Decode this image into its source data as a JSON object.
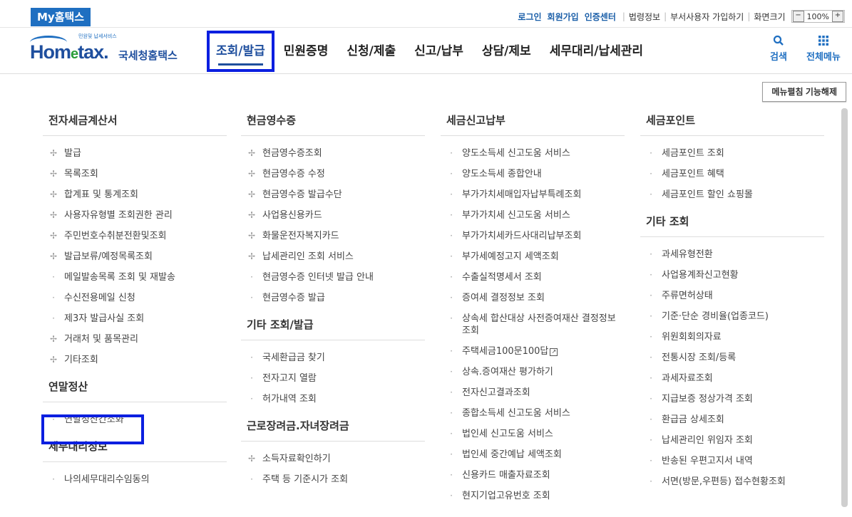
{
  "top": {
    "my_hometax": "My홈택스",
    "links": [
      "로그인",
      "회원가입",
      "인증센터"
    ],
    "plain_links": [
      "법령정보",
      "부서사용자 가입하기",
      "화면크기"
    ],
    "zoom_minus": "−",
    "zoom_value": "100%",
    "zoom_plus": "+"
  },
  "logo": {
    "small": "민원및 납세서비스",
    "word_home": "Hom",
    "word_e": "e",
    "word_tax": "tax.",
    "korean": "국세청홈택스"
  },
  "gnb": [
    "조회/발급",
    "민원증명",
    "신청/제출",
    "신고/납부",
    "상담/제보",
    "세무대리/납세관리"
  ],
  "header_icons": {
    "search": "검색",
    "all_menu": "전체메뉴"
  },
  "menu_collapse_button": "메뉴펼침 기능해제",
  "col1": {
    "s1_title": "전자세금계산서",
    "s1_items": [
      {
        "mk": "✢",
        "t": "발급"
      },
      {
        "mk": "✢",
        "t": "목록조회"
      },
      {
        "mk": "✢",
        "t": "합계표 및 통계조회"
      },
      {
        "mk": "✢",
        "t": "사용자유형별 조회권한 관리"
      },
      {
        "mk": "✢",
        "t": "주민번호수취분전환및조회"
      },
      {
        "mk": "✢",
        "t": "발급보류/예정목록조회"
      },
      {
        "mk": "·",
        "t": "메일발송목록 조회 및 재발송"
      },
      {
        "mk": "·",
        "t": "수신전용메일 신청"
      },
      {
        "mk": "·",
        "t": "제3자 발급사실 조회"
      },
      {
        "mk": "✢",
        "t": "거래처 및 품목관리"
      },
      {
        "mk": "✢",
        "t": "기타조회"
      }
    ],
    "s2_title": "연말정산",
    "s2_items": [
      {
        "mk": "·",
        "t": "연말정산간소화"
      }
    ],
    "s3_title": "세무대리정보",
    "s3_items": [
      {
        "mk": "·",
        "t": "나의세무대리수임동의"
      }
    ]
  },
  "col2": {
    "s1_title": "현금영수증",
    "s1_items": [
      {
        "mk": "✢",
        "t": "현금영수증조회"
      },
      {
        "mk": "✢",
        "t": "현금영수증 수정"
      },
      {
        "mk": "✢",
        "t": "현금영수증 발급수단"
      },
      {
        "mk": "✢",
        "t": "사업용신용카드"
      },
      {
        "mk": "✢",
        "t": "화물운전자복지카드"
      },
      {
        "mk": "✢",
        "t": "납세관리인 조회 서비스"
      },
      {
        "mk": "·",
        "t": "현금영수증 인터넷 발급 안내"
      },
      {
        "mk": "·",
        "t": "현금영수증 발급"
      }
    ],
    "s2_title": "기타 조회/발급",
    "s2_items": [
      {
        "mk": "·",
        "t": "국세환급금 찾기"
      },
      {
        "mk": "·",
        "t": "전자고지 열람"
      },
      {
        "mk": "·",
        "t": "허가내역 조회"
      }
    ],
    "s3_title": "근로장려금.자녀장려금",
    "s3_items": [
      {
        "mk": "✢",
        "t": "소득자료확인하기"
      },
      {
        "mk": "·",
        "t": "주택 등 기준시가 조회"
      }
    ]
  },
  "col3": {
    "s1_title": "세금신고납부",
    "s1_items": [
      {
        "mk": "·",
        "t": "양도소득세 신고도움 서비스"
      },
      {
        "mk": "·",
        "t": "양도소득세 종합안내"
      },
      {
        "mk": "·",
        "t": "부가가치세매입자납부특례조회"
      },
      {
        "mk": "·",
        "t": "부가가치세 신고도움 서비스"
      },
      {
        "mk": "·",
        "t": "부가가치세카드사대리납부조회"
      },
      {
        "mk": "·",
        "t": "부가세예정고지 세액조회"
      },
      {
        "mk": "·",
        "t": "수출실적명세서 조회"
      },
      {
        "mk": "·",
        "t": "증여세 결정정보 조회"
      },
      {
        "mk": "·",
        "t": "상속세 합산대상 사전증여재산 결정정보 조회"
      },
      {
        "mk": "·",
        "t": "주택세금100문100답"
      },
      {
        "mk": "·",
        "t": "상속.증여재산 평가하기"
      },
      {
        "mk": "·",
        "t": "전자신고결과조회"
      },
      {
        "mk": "·",
        "t": "종합소득세 신고도움 서비스"
      },
      {
        "mk": "·",
        "t": "법인세 신고도움 서비스"
      },
      {
        "mk": "·",
        "t": "법인세 중간예납 세액조회"
      },
      {
        "mk": "·",
        "t": "신용카드 매출자료조회"
      },
      {
        "mk": "·",
        "t": "현지기업고유번호 조회"
      }
    ]
  },
  "col4": {
    "s1_title": "세금포인트",
    "s1_items": [
      {
        "mk": "·",
        "t": "세금포인트 조회"
      },
      {
        "mk": "·",
        "t": "세금포인트 혜택"
      },
      {
        "mk": "·",
        "t": "세금포인트 할인 쇼핑몰"
      }
    ],
    "s2_title": "기타 조회",
    "s2_items": [
      {
        "mk": "·",
        "t": "과세유형전환"
      },
      {
        "mk": "·",
        "t": "사업용계좌신고현황"
      },
      {
        "mk": "·",
        "t": "주류면허상태"
      },
      {
        "mk": "·",
        "t": "기준·단순 경비율(업종코드)"
      },
      {
        "mk": "·",
        "t": "위원회회의자료"
      },
      {
        "mk": "·",
        "t": "전통시장 조회/등록"
      },
      {
        "mk": "·",
        "t": "과세자료조회"
      },
      {
        "mk": "·",
        "t": "지급보증 정상가격 조회"
      },
      {
        "mk": "·",
        "t": "환급금 상세조회"
      },
      {
        "mk": "·",
        "t": "납세관리인 위임자 조회"
      },
      {
        "mk": "·",
        "t": "반송된 우편고지서 내역"
      },
      {
        "mk": "·",
        "t": "서면(방문,우편등) 접수현황조회"
      }
    ]
  }
}
